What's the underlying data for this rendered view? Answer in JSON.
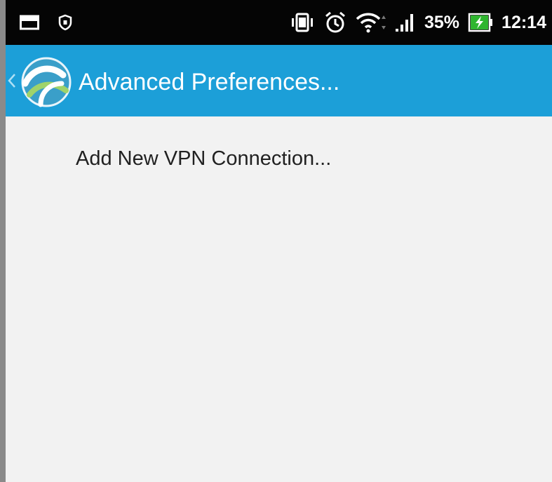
{
  "status_bar": {
    "icons_left": [
      "notification-window-icon",
      "shield-notification-icon"
    ],
    "icons_right": [
      "vibrate-icon",
      "alarm-icon",
      "wifi-icon",
      "signal-icon",
      "battery-charging-icon"
    ],
    "battery_percent": "35%",
    "time": "12:14"
  },
  "action_bar": {
    "title": "Advanced Preferences...",
    "background_color": "#1c9fd8",
    "icons": [
      "back-chevron-icon",
      "app-logo-icon"
    ]
  },
  "menu": {
    "items": [
      {
        "label": "Add New VPN Connection..."
      }
    ]
  }
}
